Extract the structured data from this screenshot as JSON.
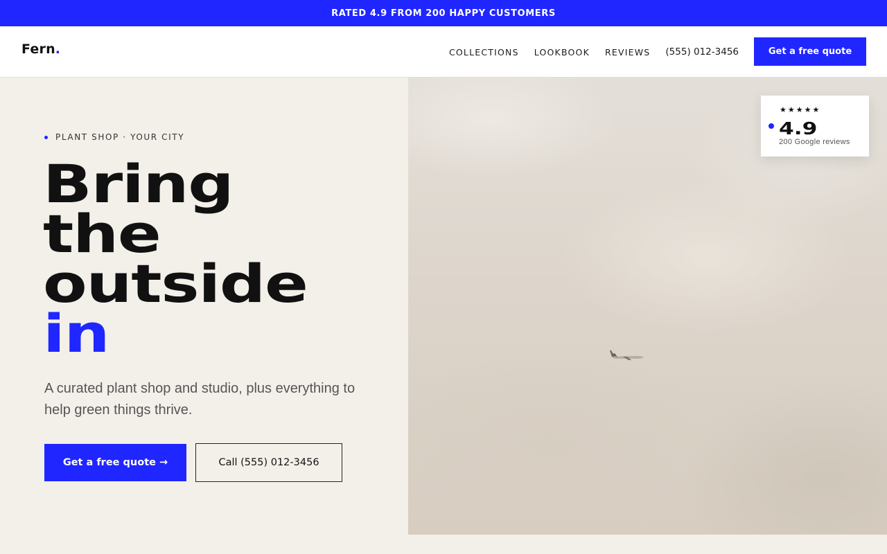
{
  "announcement": {
    "text": "RATED 4.9 FROM 200 HAPPY CUSTOMERS"
  },
  "nav": {
    "logo_text": "Fern",
    "logo_dot": ".",
    "links": [
      "COLLECTIONS",
      "LOOKBOOK",
      "REVIEWS"
    ],
    "phone": "(555) 012-3456",
    "cta_label": "Get a free quote"
  },
  "hero": {
    "eyebrow": "PLANT SHOP · YOUR CITY",
    "headline_lines": [
      "Bring",
      "the",
      "outside"
    ],
    "headline_accent": "in",
    "subtext": "A curated plant shop and studio, plus everything to help green things thrive.",
    "primary_button": "Get a free quote →",
    "secondary_button": "Call (555) 012-3456"
  },
  "rating_card": {
    "stars": "★★★★★",
    "value": "4.9",
    "subtext": "200 Google reviews"
  },
  "colors": {
    "accent": "#1f26ff",
    "background": "#f3f0ea",
    "text": "#111111"
  }
}
